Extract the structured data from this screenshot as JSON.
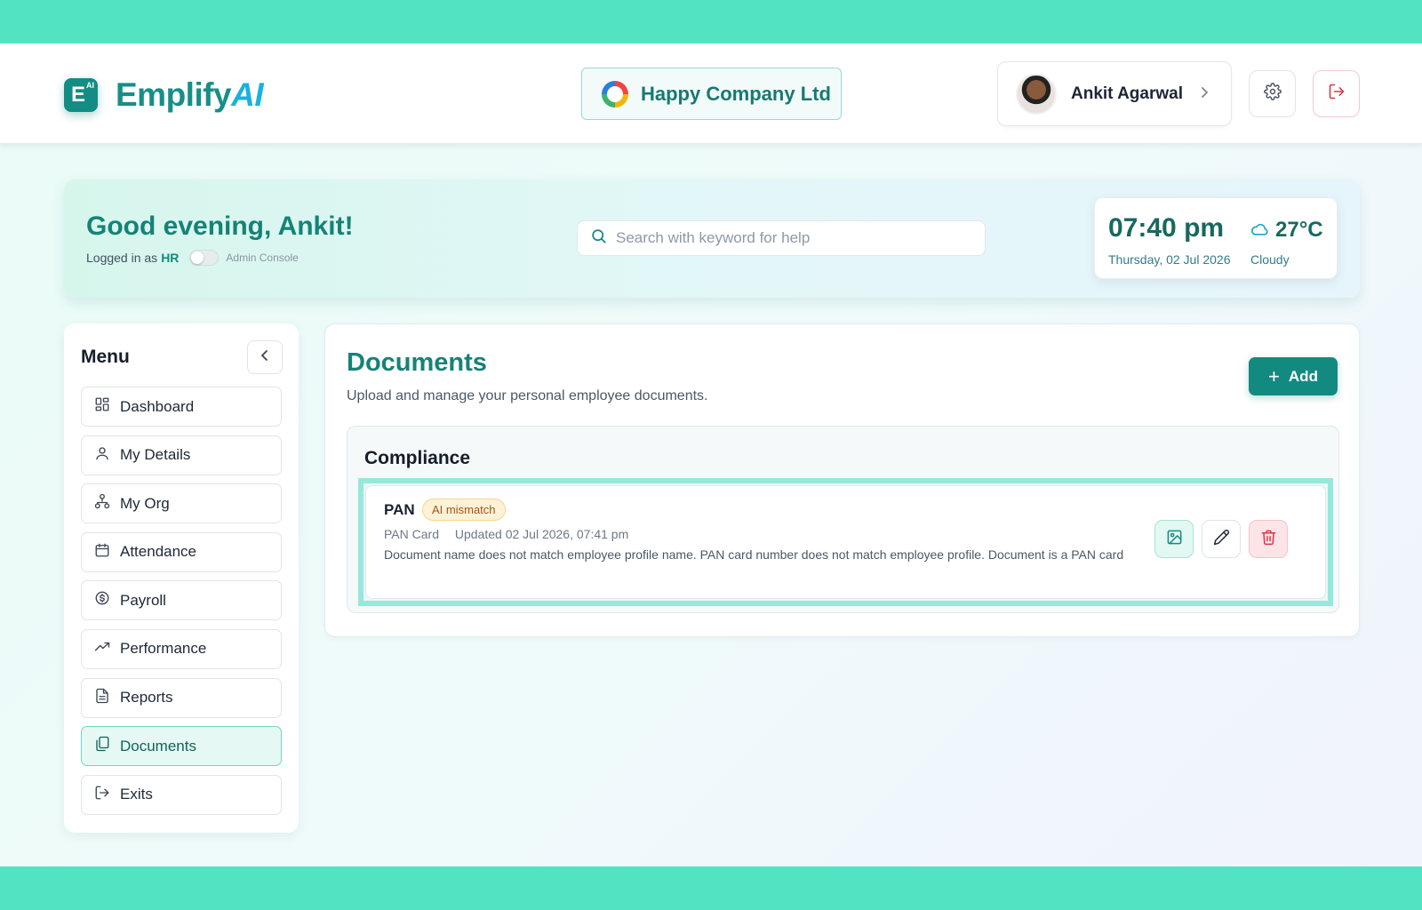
{
  "brand": {
    "name_main": "Emplify",
    "name_ai": "AI",
    "badge_letter": "E",
    "badge_sup": "AI"
  },
  "company": {
    "name": "Happy Company Ltd"
  },
  "user": {
    "name": "Ankit Agarwal"
  },
  "banner": {
    "greeting": "Good evening, Ankit!",
    "logged_prefix": "Logged in as",
    "role": "HR",
    "admin_toggle_label": "Admin Console",
    "admin_toggle_on": false
  },
  "search": {
    "placeholder": "Search with keyword for help",
    "value": ""
  },
  "clock": {
    "time": "07:40 pm",
    "date": "Thursday, 02 Jul 2026",
    "temperature": "27°C",
    "weather": "Cloudy"
  },
  "sidebar": {
    "title": "Menu",
    "items": [
      {
        "label": "Dashboard",
        "icon": "dashboard-icon"
      },
      {
        "label": "My Details",
        "icon": "user-icon"
      },
      {
        "label": "My Org",
        "icon": "org-chart-icon"
      },
      {
        "label": "Attendance",
        "icon": "calendar-icon"
      },
      {
        "label": "Payroll",
        "icon": "dollar-icon"
      },
      {
        "label": "Performance",
        "icon": "trending-up-icon"
      },
      {
        "label": "Reports",
        "icon": "file-text-icon"
      },
      {
        "label": "Documents",
        "icon": "copy-icon",
        "active": true
      },
      {
        "label": "Exits",
        "icon": "logout-icon"
      }
    ]
  },
  "main": {
    "title": "Documents",
    "subtitle": "Upload and manage your personal employee documents.",
    "add_label": "Add",
    "sections": [
      {
        "title": "Compliance",
        "documents": [
          {
            "name": "PAN",
            "badge": "AI mismatch",
            "type": "PAN Card",
            "updated": "Updated 02 Jul 2026, 07:41 pm",
            "description": "Document name does not match employee profile name. PAN card number does not match employee profile. Document is a PAN card"
          }
        ]
      }
    ]
  },
  "colors": {
    "brand": "#168f87",
    "accent_blue": "#19b2de",
    "frame": "#52e3c2",
    "badge_bg": "#fdf2d7",
    "badge_text": "#a4541a",
    "danger": "#e0344a"
  }
}
